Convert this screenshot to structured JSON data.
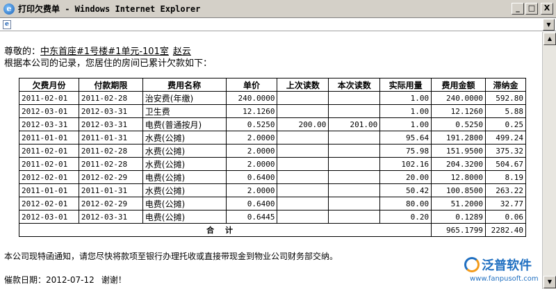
{
  "window": {
    "title": "打印欠费单 - Windows Internet Explorer",
    "buttons": {
      "minimize": "_",
      "maximize": "□",
      "close": "X"
    }
  },
  "address_bar": {
    "page_icon": "ie-page-icon"
  },
  "letter": {
    "greeting": "尊敬的：",
    "address": "中东首座#1号楼#1单元-101室",
    "resident_name": "赵云",
    "intro": "根据本公司的记录，您居住的房间已累计欠款如下：",
    "notice": "本公司现特函通知，请您尽快将款项至银行办理托收或直接带现金到物业公司财务部交纳。",
    "date_label": "催款日期：",
    "date": "2012-07-12",
    "thanks": "谢谢！"
  },
  "table": {
    "headers": [
      "欠费月份",
      "付款期限",
      "费用名称",
      "单价",
      "上次读数",
      "本次读数",
      "实际用量",
      "费用金额",
      "滞纳金"
    ],
    "rows": [
      [
        "2011-02-01",
        "2011-02-28",
        "治安费(年缴)",
        "240.0000",
        "",
        "",
        "1.00",
        "240.0000",
        "592.80"
      ],
      [
        "2012-03-01",
        "2012-03-31",
        "卫生费",
        "12.1260",
        "",
        "",
        "1.00",
        "12.1260",
        "5.88"
      ],
      [
        "2012-03-31",
        "2012-03-31",
        "电费(普通按月)",
        "0.5250",
        "200.00",
        "201.00",
        "1.00",
        "0.5250",
        "0.25"
      ],
      [
        "2011-01-01",
        "2011-01-31",
        "水费(公摊)",
        "2.0000",
        "",
        "",
        "95.64",
        "191.2800",
        "499.24"
      ],
      [
        "2011-02-01",
        "2011-02-28",
        "水费(公摊)",
        "2.0000",
        "",
        "",
        "75.98",
        "151.9500",
        "375.32"
      ],
      [
        "2011-02-01",
        "2011-02-28",
        "水费(公摊)",
        "2.0000",
        "",
        "",
        "102.16",
        "204.3200",
        "504.67"
      ],
      [
        "2012-02-01",
        "2012-02-29",
        "电费(公摊)",
        "0.6400",
        "",
        "",
        "20.00",
        "12.8000",
        "8.19"
      ],
      [
        "2011-01-01",
        "2011-01-31",
        "水费(公摊)",
        "2.0000",
        "",
        "",
        "50.42",
        "100.8500",
        "263.22"
      ],
      [
        "2012-02-01",
        "2012-02-29",
        "电费(公摊)",
        "0.6400",
        "",
        "",
        "80.00",
        "51.2000",
        "32.77"
      ],
      [
        "2012-03-01",
        "2012-03-31",
        "电费(公摊)",
        "0.6445",
        "",
        "",
        "0.20",
        "0.1289",
        "0.06"
      ]
    ],
    "total_label": "合计",
    "total_amount": "965.1799",
    "total_late_fee": "2282.40"
  },
  "logo": {
    "text": "泛普软件",
    "url": "www.fanpusoft.com"
  },
  "colors": {
    "chrome": "#d4d0c8",
    "brand_blue": "#1f6fc1",
    "brand_orange": "#f39b1a"
  }
}
